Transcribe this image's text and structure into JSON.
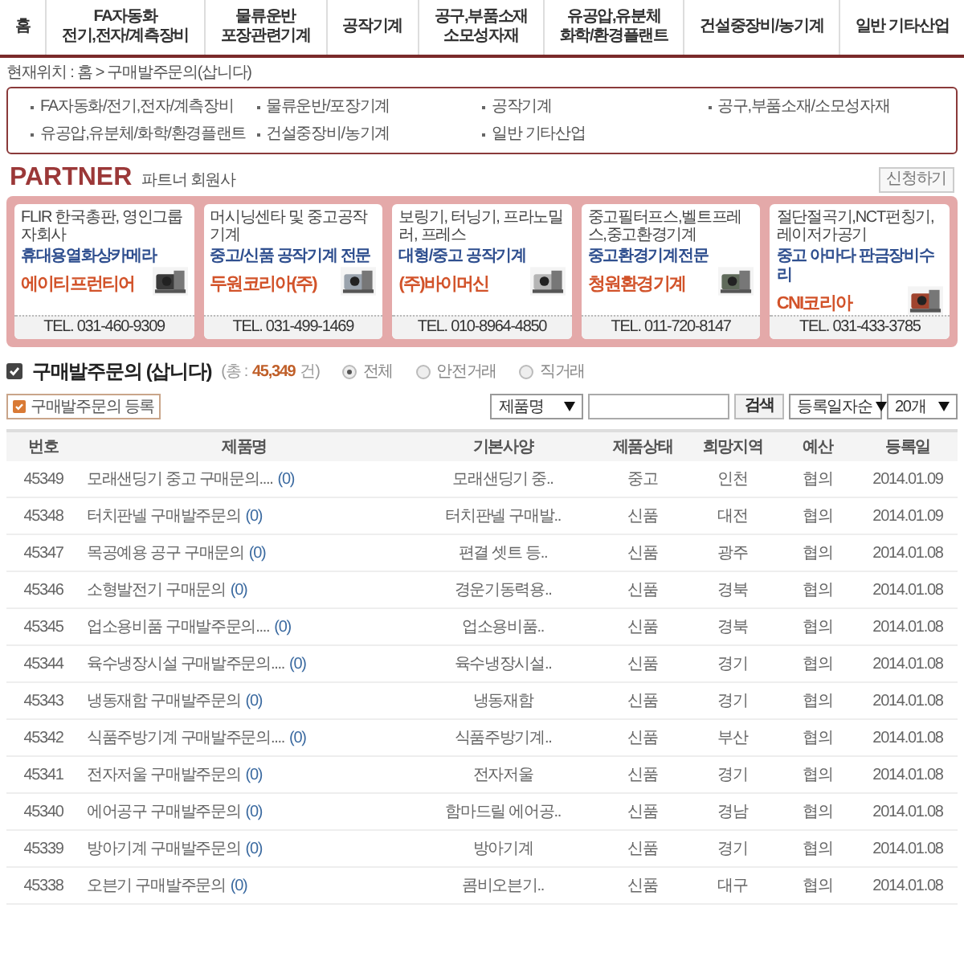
{
  "nav": [
    {
      "label": "홈"
    },
    {
      "label": "FA자동화\n전기,전자/계측장비"
    },
    {
      "label": "물류운반\n포장관련기계"
    },
    {
      "label": "공작기계"
    },
    {
      "label": "공구,부품소재\n소모성자재"
    },
    {
      "label": "유공압,유분체\n화학/환경플랜트"
    },
    {
      "label": "건설중장비/농기계"
    },
    {
      "label": "일반 기타산업"
    }
  ],
  "breadcrumb": "현재위치 : 홈 > 구매발주문의(삽니다)",
  "categories": [
    "FA자동화/전기,전자/계측장비",
    "물류운반/포장기계",
    "공작기계",
    "공구,부품소재/소모성자재",
    "유공압,유분체/화학/환경플랜트",
    "건설중장비/농기계",
    "일반 기타산업"
  ],
  "partner": {
    "title": "PARTNER",
    "subtitle": "파트너 회원사",
    "apply_button": "신청하기",
    "cards": [
      {
        "tagline": "FLIR 한국총판, 영인그룹 자회사",
        "headline": "휴대용열화상카메라",
        "company": "에이티프런티어",
        "tel": "TEL. 031-460-9309"
      },
      {
        "tagline": "머시닝센타 및 중고공작기계",
        "headline": "중고/신품 공작기계 전문",
        "company": "두원코리아(주)",
        "tel": "TEL. 031-499-1469"
      },
      {
        "tagline": "보링기, 터닝기, 프라노밀러, 프레스",
        "headline": "대형/중고 공작기계",
        "company": "(주)바이머신",
        "tel": "TEL. 010-8964-4850"
      },
      {
        "tagline": "중고필터프스,벨트프레스,중고환경기계",
        "headline": "중고환경기계전문",
        "company": "청원환경기계",
        "tel": "TEL. 011-720-8147"
      },
      {
        "tagline": "절단절곡기,NCT펀칭기,레이저가공기",
        "headline": "중고 아마다 판금장비수리",
        "company": "CNI코리아",
        "tel": "TEL. 031-433-3785"
      }
    ]
  },
  "list": {
    "title": "구매발주문의 (삽니다)",
    "count_prefix": "(총 :",
    "count": "45,349",
    "count_suffix": "건)",
    "filters": [
      {
        "label": "전체",
        "selected": true
      },
      {
        "label": "안전거래",
        "selected": false
      },
      {
        "label": "직거래",
        "selected": false
      }
    ],
    "register_button": "구매발주문의 등록",
    "search_field_select": "제품명",
    "search_button": "검색",
    "sort_select": "등록일자순",
    "page_size_select": "20개"
  },
  "table": {
    "columns": [
      "번호",
      "제품명",
      "기본사양",
      "제품상태",
      "희망지역",
      "예산",
      "등록일"
    ],
    "rows": [
      {
        "no": "45349",
        "title": "모래샌딩기 중고 구매문의....",
        "comments": "(0)",
        "spec": "모래샌딩기 중..",
        "condition": "중고",
        "region": "인천",
        "budget": "협의",
        "date": "2014.01.09"
      },
      {
        "no": "45348",
        "title": "터치판넬 구매발주문의",
        "comments": "(0)",
        "spec": "터치판넬 구매발..",
        "condition": "신품",
        "region": "대전",
        "budget": "협의",
        "date": "2014.01.09"
      },
      {
        "no": "45347",
        "title": "목공예용 공구 구매문의",
        "comments": "(0)",
        "spec": "편결 셋트 등..",
        "condition": "신품",
        "region": "광주",
        "budget": "협의",
        "date": "2014.01.08"
      },
      {
        "no": "45346",
        "title": "소형발전기 구매문의",
        "comments": "(0)",
        "spec": "경운기동력용..",
        "condition": "신품",
        "region": "경북",
        "budget": "협의",
        "date": "2014.01.08"
      },
      {
        "no": "45345",
        "title": "업소용비품 구매발주문의....",
        "comments": "(0)",
        "spec": "업소용비품..",
        "condition": "신품",
        "region": "경북",
        "budget": "협의",
        "date": "2014.01.08"
      },
      {
        "no": "45344",
        "title": "육수냉장시설 구매발주문의....",
        "comments": "(0)",
        "spec": "육수냉장시설..",
        "condition": "신품",
        "region": "경기",
        "budget": "협의",
        "date": "2014.01.08"
      },
      {
        "no": "45343",
        "title": "냉동재함 구매발주문의",
        "comments": "(0)",
        "spec": "냉동재함",
        "condition": "신품",
        "region": "경기",
        "budget": "협의",
        "date": "2014.01.08"
      },
      {
        "no": "45342",
        "title": "식품주방기계 구매발주문의....",
        "comments": "(0)",
        "spec": "식품주방기계..",
        "condition": "신품",
        "region": "부산",
        "budget": "협의",
        "date": "2014.01.08"
      },
      {
        "no": "45341",
        "title": "전자저울 구매발주문의",
        "comments": "(0)",
        "spec": "전자저울",
        "condition": "신품",
        "region": "경기",
        "budget": "협의",
        "date": "2014.01.08"
      },
      {
        "no": "45340",
        "title": "에어공구 구매발주문의",
        "comments": "(0)",
        "spec": "함마드릴 에어공..",
        "condition": "신품",
        "region": "경남",
        "budget": "협의",
        "date": "2014.01.08"
      },
      {
        "no": "45339",
        "title": "방아기계 구매발주문의",
        "comments": "(0)",
        "spec": "방아기계",
        "condition": "신품",
        "region": "경기",
        "budget": "협의",
        "date": "2014.01.08"
      },
      {
        "no": "45338",
        "title": "오븐기 구매발주문의",
        "comments": "(0)",
        "spec": "콤비오븐기..",
        "condition": "신품",
        "region": "대구",
        "budget": "협의",
        "date": "2014.01.08"
      }
    ]
  }
}
